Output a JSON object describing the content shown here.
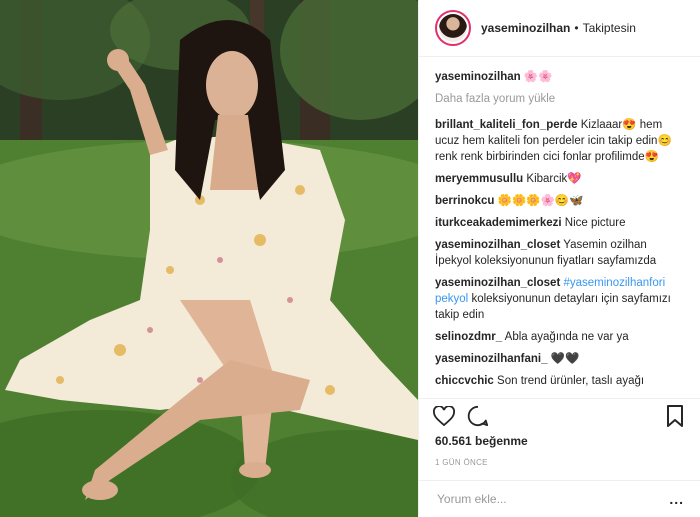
{
  "post": {
    "username": "yaseminozilhan",
    "separator": "•",
    "follow_status": "Takiptesin",
    "caption_user": "yaseminozilhan",
    "caption_text": "🌸🌸",
    "load_more": "Daha fazla yorum yükle",
    "comments": [
      {
        "user": "brillant_kaliteli_fon_perde",
        "text": "Kizlaaar😍 hem ucuz hem kaliteli fon perdeler icin takip edin😊 renk renk birbirinden cici fonlar profilimde😍"
      },
      {
        "user": "meryemmusullu",
        "text": "Kibarcik💖"
      },
      {
        "user": "berrinokcu",
        "text": "🌼🌼🌼🌸😊🦋"
      },
      {
        "user": "iturkceakademimerkezi",
        "text": "Nice picture"
      },
      {
        "user": "yaseminozilhan_closet",
        "text": "Yasemin ozilhan İpekyol koleksiyonunun fiyatları sayfamızda"
      },
      {
        "user": "yaseminozilhan_closet",
        "hashtag": "#yaseminozilhanfori pekyol",
        "text": " koleksiyonunun detayları için sayfamızı takip edin"
      },
      {
        "user": "selinozdmr_",
        "text": "Abla ayağında ne var ya"
      },
      {
        "user": "yaseminozilhanfani_",
        "text": "🖤🖤"
      },
      {
        "user": "chiccvchic",
        "text": "Son trend ürünler, taslı ayağı"
      }
    ],
    "likes": "60.561 beğenme",
    "time": "1 GÜN ÖNCE",
    "comment_placeholder": "Yorum ekle...",
    "more_label": "..."
  },
  "icons": {
    "like": "heart-icon",
    "comment": "comment-icon",
    "save": "bookmark-icon"
  }
}
